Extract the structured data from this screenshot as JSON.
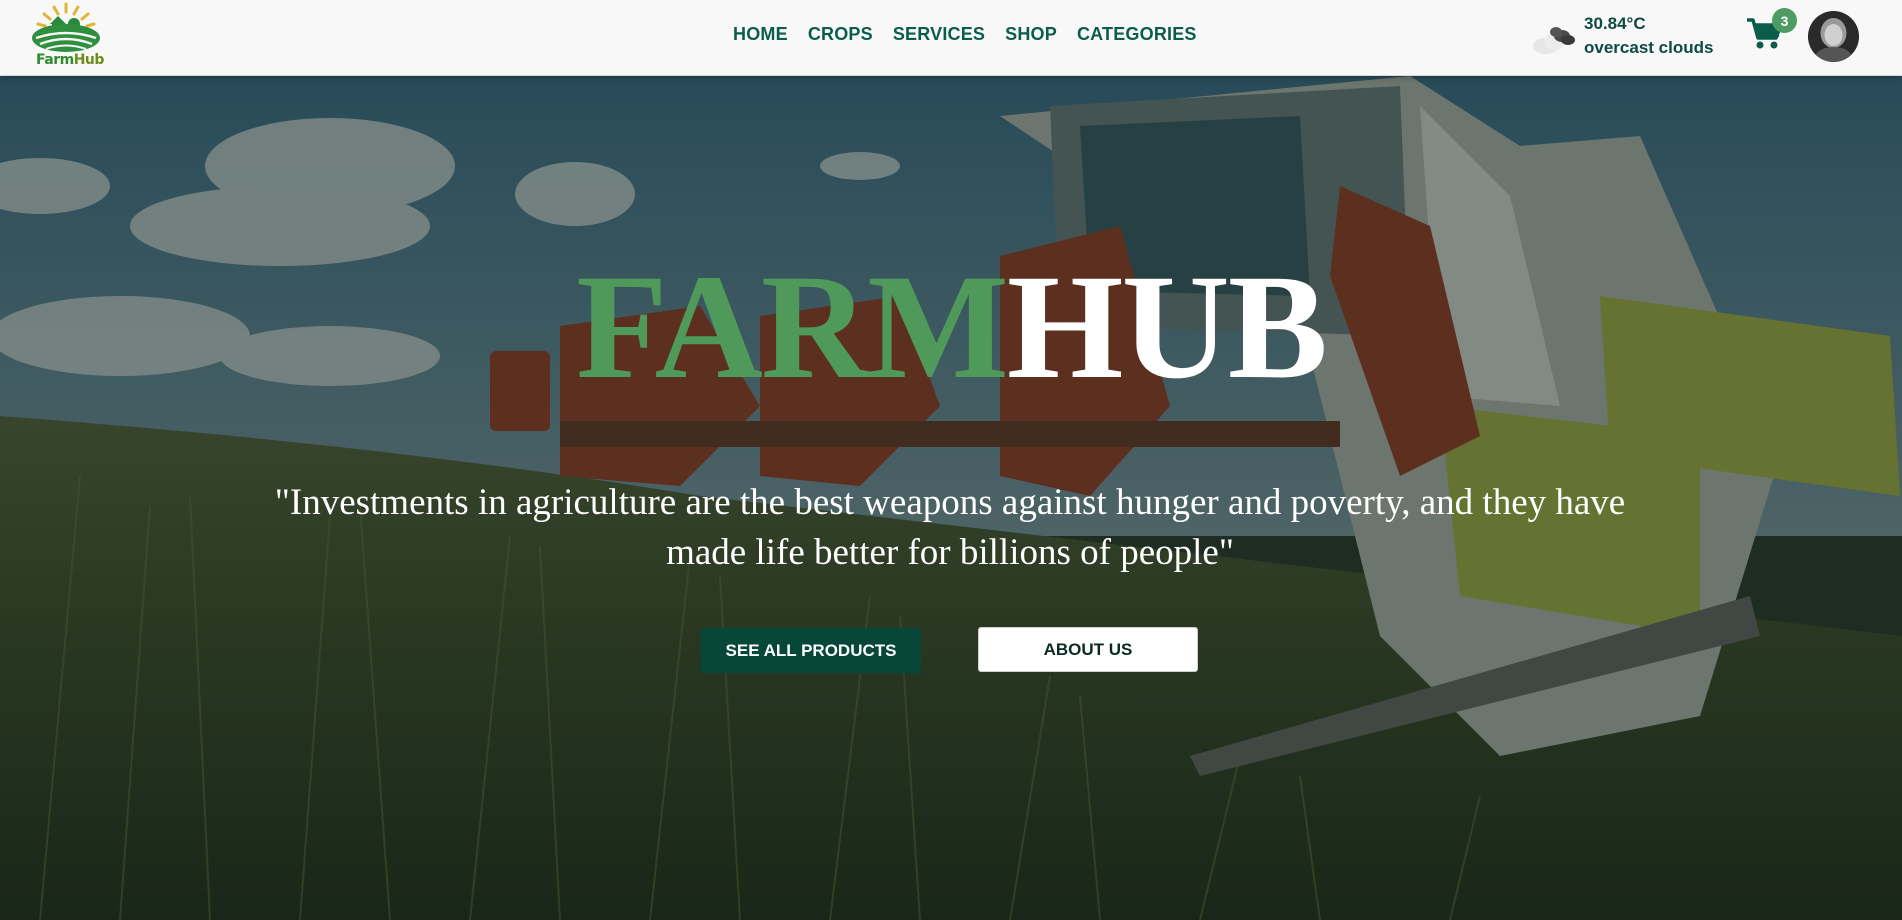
{
  "header": {
    "logo_text_1": "Farm",
    "logo_text_2": "Hub",
    "nav": [
      {
        "label": "HOME"
      },
      {
        "label": "CROPS"
      },
      {
        "label": "SERVICES"
      },
      {
        "label": "SHOP"
      },
      {
        "label": "CATEGORIES"
      }
    ],
    "weather": {
      "icon": "cloud-icon",
      "temperature": "30.84°C",
      "description": "overcast clouds"
    },
    "cart": {
      "icon": "cart-icon",
      "count": "3"
    },
    "avatar": "user-avatar"
  },
  "hero": {
    "title_part1": "FARM",
    "title_part2": "HUB",
    "quote": "\"Investments in agriculture are the best weapons against hunger and poverty, and they have made life better for billions of people\"",
    "primary_button": "SEE ALL PRODUCTS",
    "secondary_button": "ABOUT US"
  },
  "colors": {
    "brand_green": "#4f9a5a",
    "nav_text": "#0b5c4a",
    "primary_button_bg": "#06473a",
    "badge_bg": "#4e9b63"
  }
}
